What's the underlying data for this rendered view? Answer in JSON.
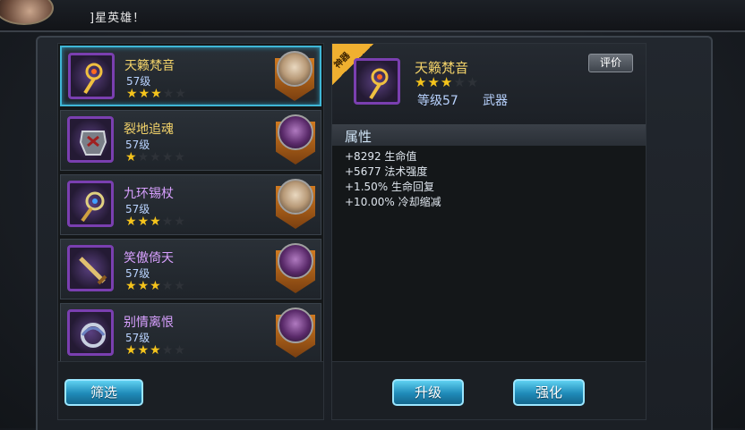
{
  "topbar": {
    "message": "]星英雄！"
  },
  "items": [
    {
      "name": "天籁梵音",
      "level": "57级",
      "stars": 3,
      "max_stars": 5,
      "icon": "golden-staff-icon",
      "hero": "light",
      "selected": true,
      "name_color": "gold"
    },
    {
      "name": "裂地追魂",
      "level": "57级",
      "stars": 1,
      "max_stars": 5,
      "icon": "armor-icon",
      "hero": "dark",
      "selected": false,
      "name_color": "gold"
    },
    {
      "name": "九环锡杖",
      "level": "57级",
      "stars": 3,
      "max_stars": 5,
      "icon": "ring-staff-icon",
      "hero": "light",
      "selected": false,
      "name_color": "purple"
    },
    {
      "name": "笑傲倚天",
      "level": "57级",
      "stars": 3,
      "max_stars": 5,
      "icon": "sword-icon",
      "hero": "dark",
      "selected": false,
      "name_color": "purple"
    },
    {
      "name": "别情离恨",
      "level": "57级",
      "stars": 3,
      "max_stars": 5,
      "icon": "blade-ring-icon",
      "hero": "dark",
      "selected": false,
      "name_color": "purple"
    }
  ],
  "detail": {
    "tag": "神器",
    "name": "天籁梵音",
    "stars": 3,
    "max_stars": 5,
    "level": "等级57",
    "type": "武器",
    "rate_label": "评价",
    "attr_title": "属性",
    "attributes": [
      "+8292 生命值",
      "+5677 法术强度",
      "+1.50% 生命回复",
      "+10.00% 冷却缩减"
    ]
  },
  "buttons": {
    "filter": "筛选",
    "upgrade": "升级",
    "enhance": "强化"
  }
}
